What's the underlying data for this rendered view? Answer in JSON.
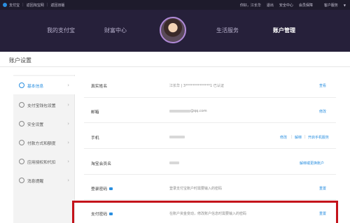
{
  "topbar": {
    "left_items": [
      "支付宝",
      "返回淘宝网",
      "返回旧版"
    ],
    "user_greeting": "你好，江长华",
    "logout": "退出",
    "right_items": [
      "安全中心",
      "会员保障",
      "客户服务"
    ]
  },
  "nav": {
    "items": [
      "我的支付宝",
      "财富中心",
      "生活服务",
      "账户管理"
    ],
    "active": "账户管理"
  },
  "page_title": "账户设置",
  "sidebar": {
    "items": [
      {
        "label": "基本信息",
        "active": true
      },
      {
        "label": "支付宝钱包设置",
        "active": false
      },
      {
        "label": "安全设置",
        "active": false
      },
      {
        "label": "付款方式和额度",
        "active": false
      },
      {
        "label": "应用授权和代扣",
        "active": false
      },
      {
        "label": "消息提醒",
        "active": false
      }
    ]
  },
  "rows": [
    {
      "label": "真实姓名",
      "value": "江长华 | 3**************1 已认证",
      "actions": [
        "查看"
      ]
    },
    {
      "label": "邮箱",
      "value": "@qq.com",
      "actions": [
        "修改"
      ]
    },
    {
      "label": "手机",
      "value": "",
      "actions": [
        "修改",
        "解绑",
        "开启手机服务"
      ]
    },
    {
      "label": "淘宝会员名",
      "value": "",
      "actions": [
        "解绑或更换账户"
      ]
    },
    {
      "label": "登录密码",
      "value": "登录支付宝账户时需要输入的密码",
      "actions": [
        "重置"
      ]
    },
    {
      "label": "支付密码",
      "value": "在账户资金变动，修改账户信息时需要输入的密码",
      "actions": [
        "重置"
      ]
    }
  ],
  "colors": {
    "accent": "#2a8fe0",
    "highlight": "#c4121a",
    "nav_bg": "#26203a"
  }
}
